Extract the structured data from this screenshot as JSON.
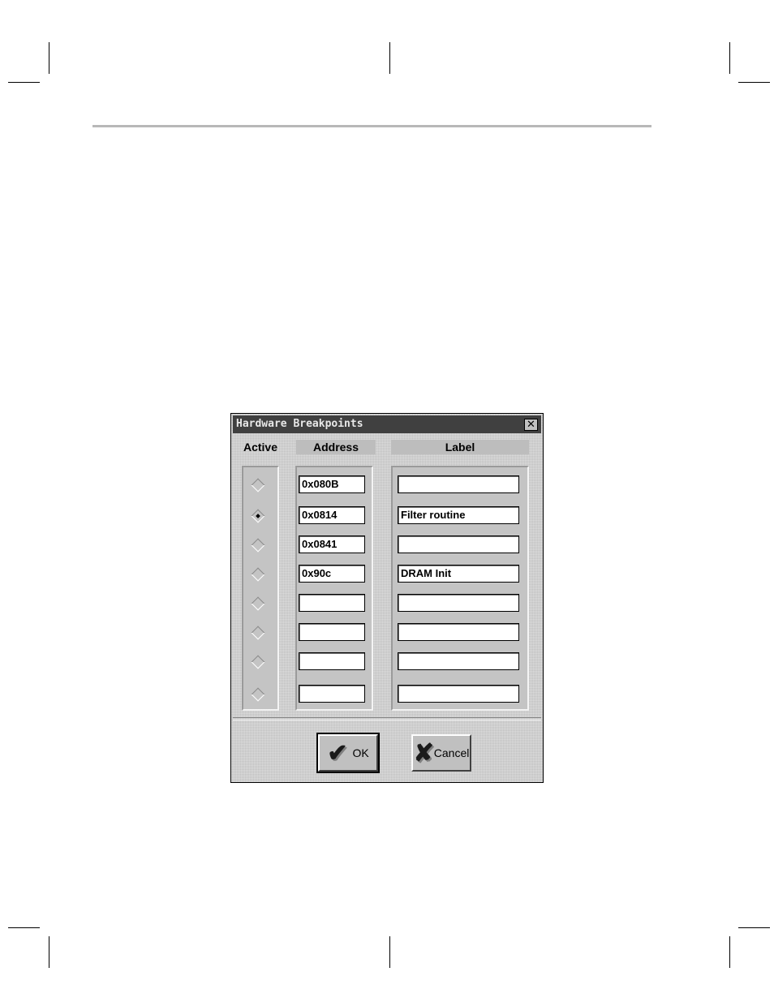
{
  "dialog": {
    "title": "Hardware Breakpoints",
    "close_glyph": "✕",
    "headers": {
      "active": "Active",
      "address": "Address",
      "label": "Label"
    },
    "rows": [
      {
        "active": false,
        "address": "0x080B",
        "label": ""
      },
      {
        "active": true,
        "address": "0x0814",
        "label": "Filter routine"
      },
      {
        "active": false,
        "address": "0x0841",
        "label": ""
      },
      {
        "active": false,
        "address": "0x90c",
        "label": "DRAM Init"
      },
      {
        "active": false,
        "address": "",
        "label": ""
      },
      {
        "active": false,
        "address": "",
        "label": ""
      },
      {
        "active": false,
        "address": "",
        "label": ""
      },
      {
        "active": false,
        "address": "",
        "label": ""
      }
    ],
    "buttons": {
      "ok": "OK",
      "ok_icon": "✔",
      "cancel": "Cancel",
      "cancel_icon": "✘"
    }
  }
}
